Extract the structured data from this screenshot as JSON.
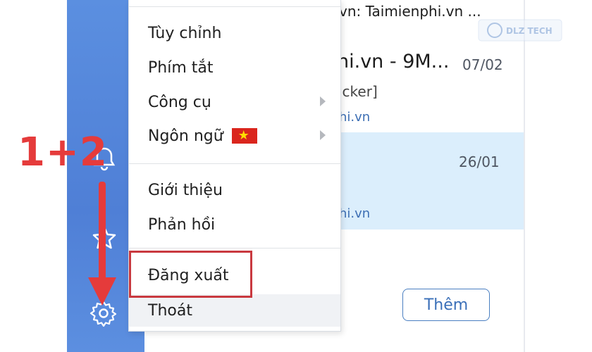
{
  "conversations": {
    "top_header": "vn: Taimienphi.vn ...",
    "row1": {
      "sender": "hi.vn - 9M...",
      "date": "07/02",
      "sub": "icker]",
      "link": "hi.vn"
    },
    "row2": {
      "date": "26/01",
      "link": "hi.vn"
    },
    "more_button": "Thêm"
  },
  "menu": {
    "items": [
      {
        "label": "Tùy chỉnh"
      },
      {
        "label": "Phím tắt"
      },
      {
        "label": "Công cụ",
        "submenu": true
      },
      {
        "label": "Ngôn ngữ",
        "submenu": true,
        "flag": "vietnam-flag"
      },
      {
        "label": "Giới thiệu"
      },
      {
        "label": "Phản hồi"
      },
      {
        "label": "Đăng xuất"
      },
      {
        "label": "Thoát"
      }
    ]
  },
  "annotation": {
    "step_label": "1+2",
    "highlight_color": "#c9393f",
    "arrow_color": "#e53b3b"
  },
  "watermark": {
    "text": "DLZ TECH"
  },
  "colors": {
    "sidebar": "#5b8fe0",
    "accent": "#3a6fb8",
    "selected_row": "#dbeefc"
  }
}
